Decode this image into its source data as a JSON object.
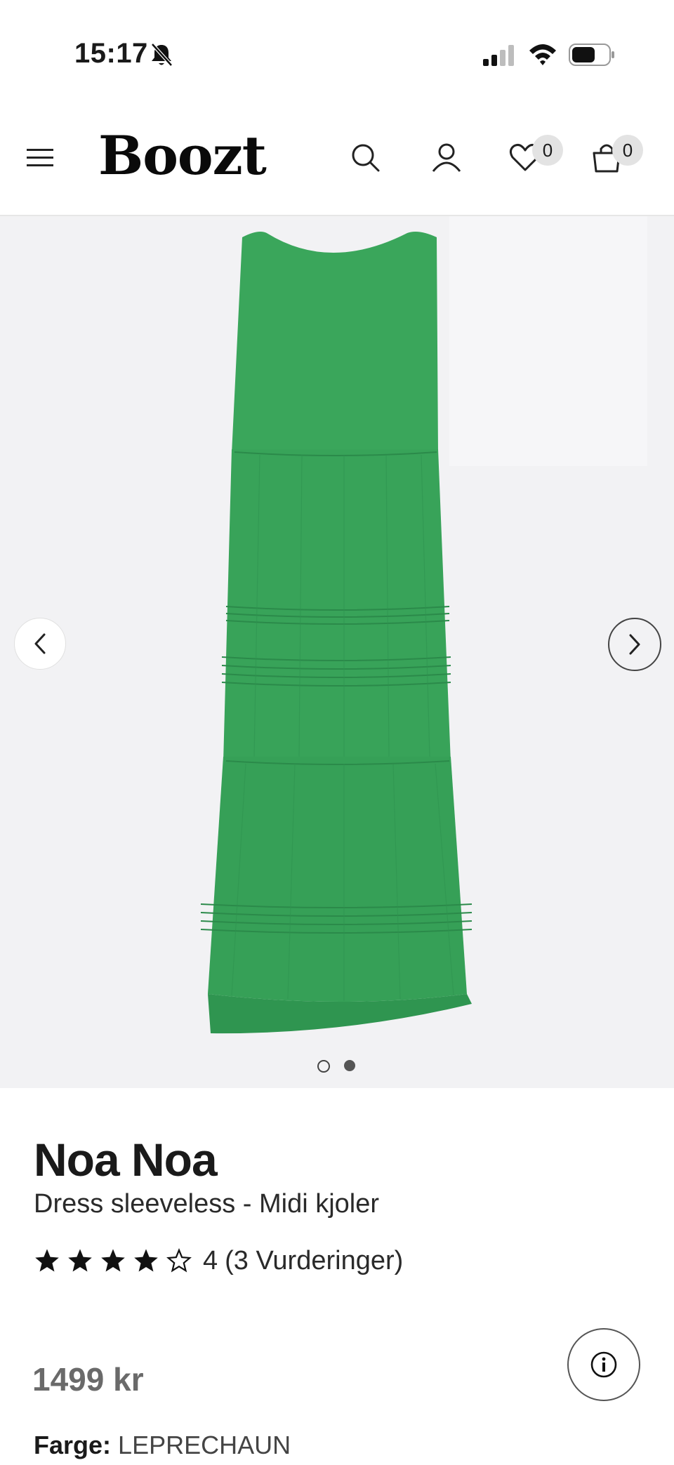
{
  "status_bar": {
    "time": "15:17",
    "icons": [
      "bell-off-icon",
      "signal-icon",
      "wifi-icon",
      "battery-icon"
    ]
  },
  "header": {
    "logo": "Boozt",
    "wishlist_count": "0",
    "bag_count": "0",
    "icons": [
      "menu-icon",
      "search-icon",
      "account-icon",
      "heart-icon",
      "bag-icon"
    ]
  },
  "gallery": {
    "image_count": 2,
    "active_index": 2,
    "dress_color": "#3aa65b",
    "background": "#f2f2f4"
  },
  "product": {
    "brand": "Noa Noa",
    "name": "Dress sleeveless - Midi kjoler",
    "rating_value": "4",
    "rating_max": 5,
    "rating_count": "(3 Vurderinger)",
    "price": "1499 kr",
    "color_label": "Farge:",
    "color_value": "LEPRECHAUN"
  }
}
